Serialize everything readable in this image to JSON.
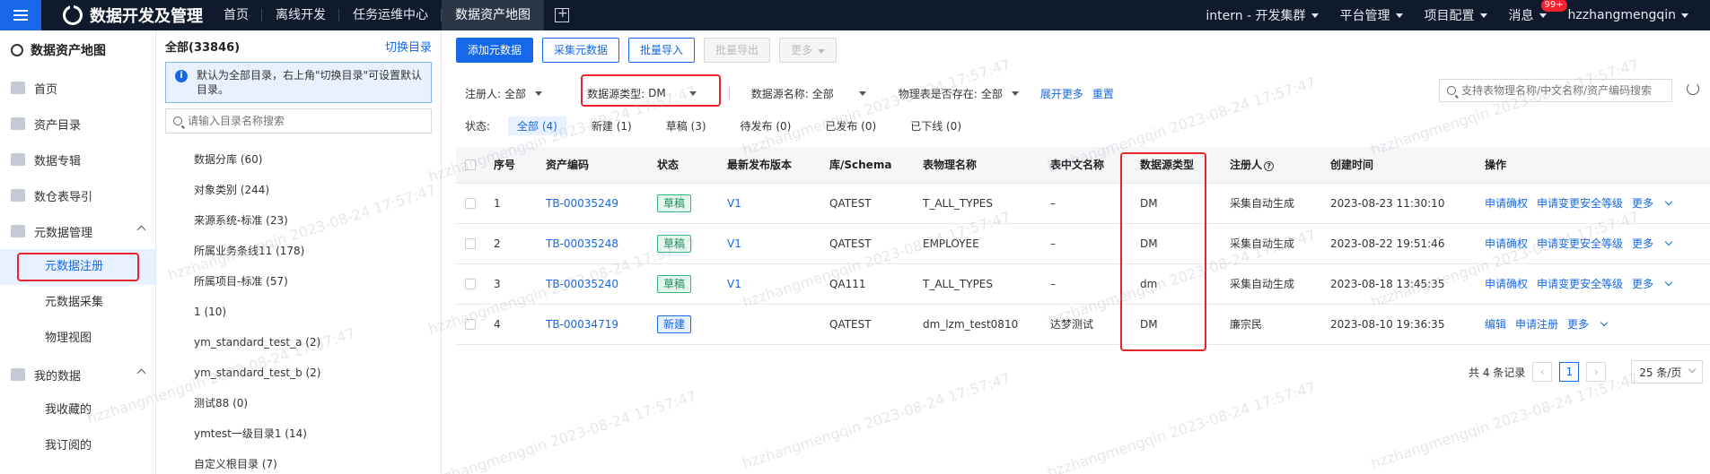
{
  "topbar": {
    "app_title": "数据开发及管理",
    "nav": [
      "首页",
      "离线开发",
      "任务运维中心",
      "数据资产地图"
    ],
    "cluster": "intern - 开发集群",
    "platform": "平台管理",
    "project": "项目配置",
    "messages": "消息",
    "message_badge": "99+",
    "user": "hzzhangmengqin"
  },
  "leftnav": {
    "title": "数据资产地图",
    "items": [
      "首页",
      "资产目录",
      "数据专辑",
      "数仓表导引",
      "元数据管理"
    ],
    "meta_subs": [
      "元数据注册",
      "元数据采集",
      "物理视图"
    ],
    "my_data": "我的数据",
    "my_subs": [
      "我收藏的",
      "我订阅的"
    ]
  },
  "tree": {
    "title": "全部(33846)",
    "switch": "切换目录",
    "info": "默认为全部目录，右上角\"切换目录\"可设置默认目录。",
    "search_placeholder": "请输入目录名称搜索",
    "items": [
      "数据分库 (60)",
      "对象类别 (244)",
      "来源系统-标准 (23)",
      "所属业务条线11 (178)",
      "所属项目-标准 (57)",
      "1 (10)",
      "ym_standard_test_a (2)",
      "ym_standard_test_b (2)",
      "测试88 (0)",
      "ymtest一级目录1 (14)",
      "自定义根目录 (7)"
    ]
  },
  "toolbar": {
    "add": "添加元数据",
    "collect": "采集元数据",
    "import": "批量导入",
    "export": "批量导出",
    "more": "更多"
  },
  "filters": {
    "registrant_label": "注册人:",
    "registrant_value": "全部",
    "ds_type_label": "数据源类型:",
    "ds_type_value": "DM",
    "ds_name_label": "数据源名称:",
    "ds_name_value": "全部",
    "phys_label": "物理表是否存在:",
    "phys_value": "全部",
    "expand": "展开更多",
    "reset": "重置",
    "search_placeholder": "支持表物理名称/中文名称/资产编码搜索"
  },
  "status": {
    "label": "状态:",
    "tabs": [
      "全部 (4)",
      "新建 (1)",
      "草稿 (3)",
      "待发布 (0)",
      "已发布 (0)",
      "已下线 (0)"
    ]
  },
  "table": {
    "headers": [
      "序号",
      "资产编码",
      "状态",
      "最新发布版本",
      "库/Schema",
      "表物理名称",
      "表中文名称",
      "数据源类型",
      "注册人",
      "创建时间",
      "操作"
    ],
    "rows": [
      {
        "no": "1",
        "code": "TB-00035249",
        "status": "草稿",
        "version": "V1",
        "schema": "QATEST",
        "phys": "T_ALL_TYPES",
        "cn": "–",
        "dstype": "DM",
        "reg": "采集自动生成",
        "time": "2023-08-23 11:30:10",
        "ops": [
          "申请确权",
          "申请变更安全等级",
          "更多"
        ]
      },
      {
        "no": "2",
        "code": "TB-00035248",
        "status": "草稿",
        "version": "V1",
        "schema": "QATEST",
        "phys": "EMPLOYEE",
        "cn": "–",
        "dstype": "DM",
        "reg": "采集自动生成",
        "time": "2023-08-22 19:51:46",
        "ops": [
          "申请确权",
          "申请变更安全等级",
          "更多"
        ]
      },
      {
        "no": "3",
        "code": "TB-00035240",
        "status": "草稿",
        "version": "V1",
        "schema": "QA111",
        "phys": "T_ALL_TYPES",
        "cn": "–",
        "dstype": "dm",
        "reg": "采集自动生成",
        "time": "2023-08-18 13:45:35",
        "ops": [
          "申请确权",
          "申请变更安全等级",
          "更多"
        ]
      },
      {
        "no": "4",
        "code": "TB-00034719",
        "status": "新建",
        "version": "",
        "schema": "QATEST",
        "phys": "dm_lzm_test0810",
        "cn": "达梦测试",
        "dstype": "DM",
        "reg": "廉宗民",
        "time": "2023-08-10 19:36:35",
        "ops": [
          "编辑",
          "申请注册",
          "更多"
        ]
      }
    ]
  },
  "pager": {
    "total": "共 4 条记录",
    "page": "1",
    "size": "25 条/页"
  },
  "watermark": "hzzhangmengqin 2023-08-24 17:57:47",
  "colors": {
    "accent": "#1668e8",
    "highlight": "#e8252a",
    "topbar": "#0f1b2d"
  }
}
